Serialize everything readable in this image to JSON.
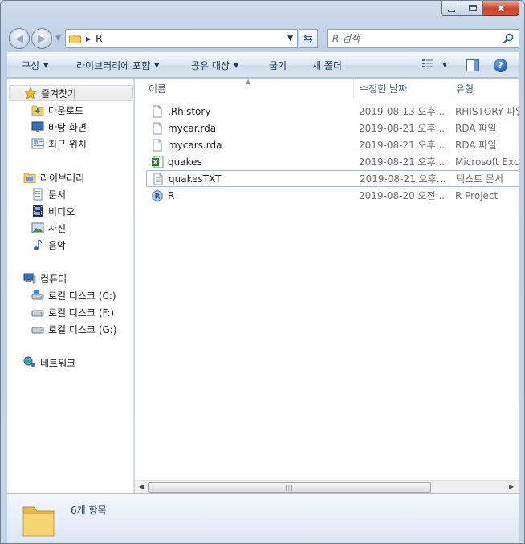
{
  "window": {
    "caption": {
      "minimize_icon": "minimize-icon",
      "maximize_icon": "maximize-icon",
      "close_glyph": "x"
    }
  },
  "address_bar": {
    "path": "R",
    "search_placeholder": "R 검색"
  },
  "toolbar": {
    "organize": "구성",
    "include_in_library": "라이브러리에 포함",
    "share_with": "공유 대상",
    "burn": "굽기",
    "new_folder": "새 폴더"
  },
  "navigation": {
    "favorites": {
      "label": "즐겨찾기",
      "items": [
        "다운로드",
        "바탕 화면",
        "최근 위치"
      ]
    },
    "libraries": {
      "label": "라이브러리",
      "items": [
        "문서",
        "비디오",
        "사진",
        "음악"
      ]
    },
    "computer": {
      "label": "컴퓨터",
      "items": [
        "로컬 디스크 (C:)",
        "로컬 디스크 (F:)",
        "로컬 디스크 (G:)"
      ]
    },
    "network": {
      "label": "네트워크"
    }
  },
  "columns": {
    "name": "이름",
    "date_modified": "수정한 날짜",
    "type": "유형"
  },
  "files": [
    {
      "name": ".Rhistory",
      "date": "2019-08-13 오후...",
      "type": "RHISTORY 파일",
      "icon": "blank-file-icon"
    },
    {
      "name": "mycar.rda",
      "date": "2019-08-21 오후...",
      "type": "RDA 파일",
      "icon": "blank-file-icon"
    },
    {
      "name": "mycars.rda",
      "date": "2019-08-21 오후...",
      "type": "RDA 파일",
      "icon": "blank-file-icon"
    },
    {
      "name": "quakes",
      "date": "2019-08-21 오후...",
      "type": "Microsoft Excel",
      "icon": "excel-file-icon"
    },
    {
      "name": "quakesTXT",
      "date": "2019-08-21 오후...",
      "type": "텍스트 문서",
      "icon": "text-file-icon"
    },
    {
      "name": "R",
      "date": "2019-08-20 오전...",
      "type": "R Project",
      "icon": "r-project-icon"
    }
  ],
  "status": {
    "item_count": "6개 항목"
  },
  "colors": {
    "accent": "#1e395b",
    "selection_border": "#a5b7cc",
    "folder_yellow": "#f2cd62",
    "close_red": "#c8452c"
  }
}
